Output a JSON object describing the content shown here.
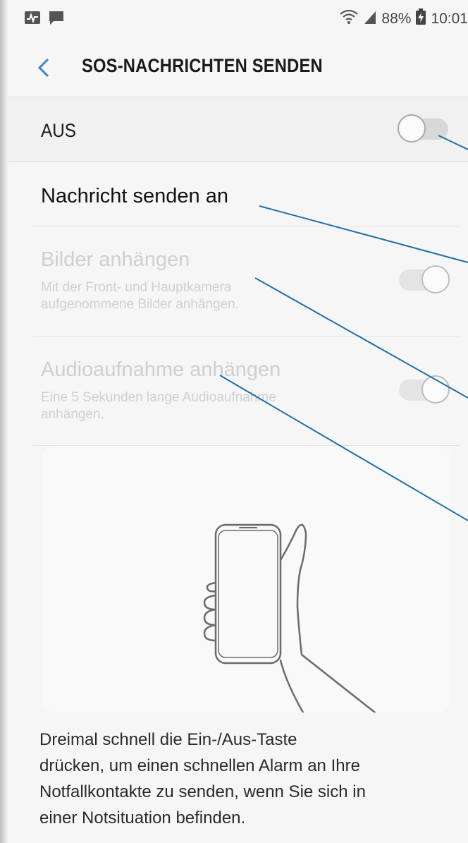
{
  "status_bar": {
    "battery": "88%",
    "time": "10:01",
    "left_icons": [
      "activity-notification-icon",
      "message-notification-icon"
    ],
    "right_icons": [
      "wifi-icon",
      "signal-icon",
      "battery-charging-icon"
    ]
  },
  "header": {
    "title": "SOS-NACHRICHTEN SENDEN"
  },
  "master_switch": {
    "label": "AUS",
    "on": false
  },
  "settings": {
    "send_to": {
      "title": "Nachricht senden an"
    },
    "attach_pictures": {
      "title": "Bilder anhängen",
      "subtitle_line1": "Mit der Front- und Hauptkamera",
      "subtitle_line2": "aufgenommene Bilder anhängen.",
      "on": true,
      "enabled": false
    },
    "attach_audio": {
      "title": "Audioaufnahme anhängen",
      "subtitle_line1": "Eine 5 Sekunden lange Audioaufnahme",
      "subtitle_line2": "anhängen.",
      "on": true,
      "enabled": false
    }
  },
  "description": {
    "line1": "Dreimal schnell die Ein-/Aus-Taste",
    "line2": "drücken, um einen schnellen Alarm an Ihre",
    "line3": "Notfallkontakte zu senden, wenn Sie sich in",
    "line4": "einer Notsituation befinden."
  },
  "colors": {
    "background": "#f6f6f6",
    "accent": "#3a86c8",
    "annotation_line": "#1f6fa8",
    "disabled_text": "#cfcfcf",
    "switch_track_disabled": "#e0e0e0"
  }
}
